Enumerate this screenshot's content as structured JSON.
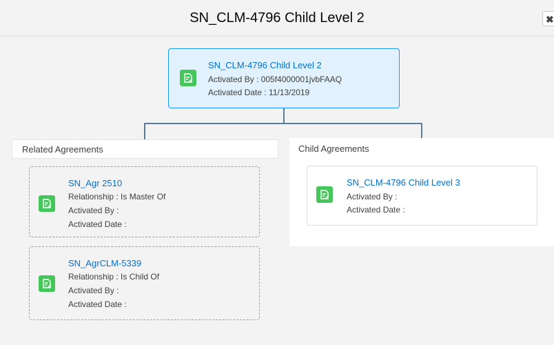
{
  "modal": {
    "title": "SN_CLM-4796 Child Level 2",
    "close_label": "✖"
  },
  "parent": {
    "title": "SN_CLM-4796 Child Level 2",
    "activated_by": "Activated By : 005f4000001jvbFAAQ",
    "activated_date": "Activated Date : 11/13/2019",
    "icon": "document-edit-icon"
  },
  "related": {
    "header": "Related Agreements",
    "items": [
      {
        "title": "SN_Agr 2510",
        "relationship": "Relationship : Is Master Of",
        "activated_by": "Activated By :",
        "activated_date": "Activated Date :"
      },
      {
        "title": "SN_AgrCLM-5339",
        "relationship": "Relationship : Is Child Of",
        "activated_by": "Activated By :",
        "activated_date": "Activated Date :"
      }
    ]
  },
  "children": {
    "header": "Child Agreements",
    "items": [
      {
        "title": "SN_CLM-4796 Child Level 3",
        "activated_by": "Activated By :",
        "activated_date": "Activated Date :"
      }
    ]
  },
  "colors": {
    "icon_green": "#45c65a",
    "link_blue": "#0070d2",
    "selected_bg": "#e1f1fd",
    "selected_border": "#1b96ff"
  }
}
